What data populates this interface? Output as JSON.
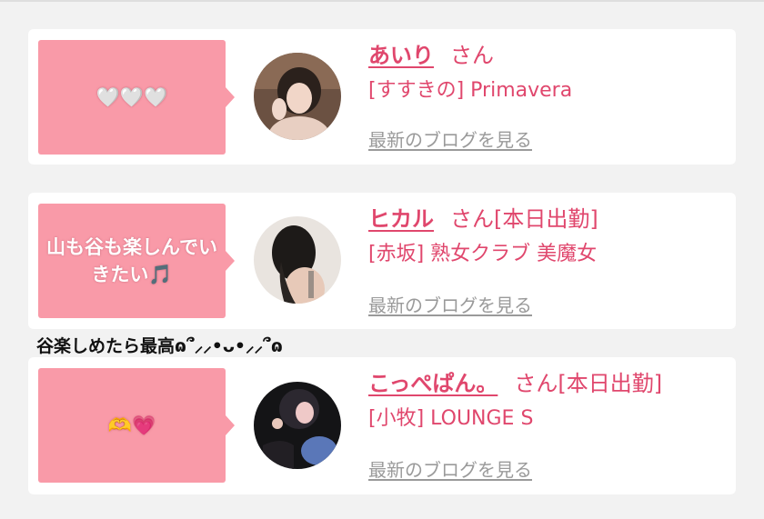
{
  "cards": [
    {
      "bubble": "🤍🤍🤍",
      "name": "あいり",
      "san": "さん",
      "today": "",
      "shop": "[すすきの] Primavera",
      "blog": "最新のブログを見る"
    },
    {
      "bubble": "山も谷も楽しんでいきたい🎵",
      "name": "ヒカル",
      "san": "さん",
      "today": "[本日出勤]",
      "shop": "[赤坂] 熟女クラブ 美魔女",
      "blog": "最新のブログを見る"
    },
    {
      "bubble": "🫶💗",
      "name": "こっぺぱん。",
      "san": "さん",
      "today": "[本日出勤]",
      "shop": "[小牧] LOUNGE S",
      "blog": "最新のブログを見る"
    }
  ],
  "caption": "谷楽しめたら最高ɷ՞⸝⸝•ᴗ•⸝⸝՞ɷ",
  "colors": {
    "accent": "#e0476d",
    "bubble": "#f99aa8",
    "link_gray": "#9a9a9a"
  }
}
